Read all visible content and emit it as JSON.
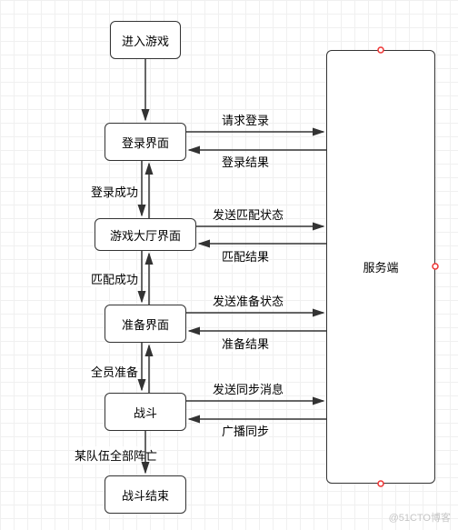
{
  "chart_data": {
    "type": "diagram",
    "nodes": [
      {
        "id": "enter",
        "label": "进入游戏"
      },
      {
        "id": "login",
        "label": "登录界面"
      },
      {
        "id": "lobby",
        "label": "游戏大厅界面"
      },
      {
        "id": "ready",
        "label": "准备界面"
      },
      {
        "id": "battle",
        "label": "战斗"
      },
      {
        "id": "end",
        "label": "战斗结束"
      },
      {
        "id": "server",
        "label": "服务端"
      }
    ],
    "edges": [
      {
        "from": "enter",
        "to": "login",
        "label": ""
      },
      {
        "from": "login",
        "to": "lobby",
        "label": "登录成功",
        "bidir": true
      },
      {
        "from": "lobby",
        "to": "ready",
        "label": "匹配成功",
        "bidir": true
      },
      {
        "from": "ready",
        "to": "battle",
        "label": "全员准备",
        "bidir": true
      },
      {
        "from": "battle",
        "to": "end",
        "label": "某队伍全部阵亡"
      },
      {
        "from": "login",
        "to": "server",
        "label": "请求登录"
      },
      {
        "from": "server",
        "to": "login",
        "label": "登录结果"
      },
      {
        "from": "lobby",
        "to": "server",
        "label": "发送匹配状态"
      },
      {
        "from": "server",
        "to": "lobby",
        "label": "匹配结果"
      },
      {
        "from": "ready",
        "to": "server",
        "label": "发送准备状态"
      },
      {
        "from": "server",
        "to": "ready",
        "label": "准备结果"
      },
      {
        "from": "battle",
        "to": "server",
        "label": "发送同步消息"
      },
      {
        "from": "server",
        "to": "battle",
        "label": "广播同步"
      }
    ]
  },
  "watermark": "@51CTO博客"
}
